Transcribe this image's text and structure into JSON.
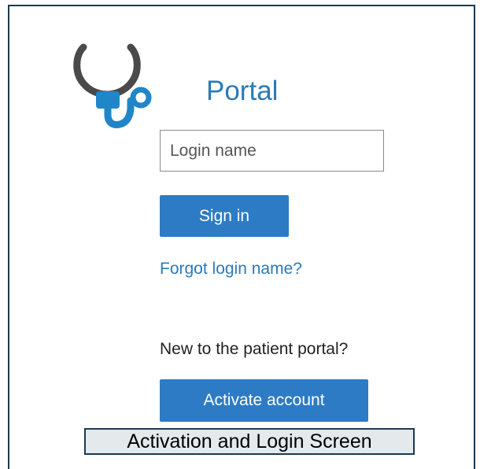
{
  "header": {
    "logo_icon": "stethoscope-icon",
    "title": "Portal"
  },
  "login": {
    "placeholder": "Login name",
    "value": "",
    "sign_in_label": "Sign in",
    "forgot_label": "Forgot login name?"
  },
  "activation": {
    "prompt": "New to the patient portal?",
    "activate_label": "Activate account"
  },
  "caption": {
    "text": "Activation and Login Screen"
  },
  "colors": {
    "accent": "#2d7bc4",
    "title_blue": "#2a7ab8",
    "logo_gray": "#4a4a4a",
    "logo_blue": "#1f86c8",
    "frame_border": "#1b3a52",
    "caption_bg": "#e4e9ec"
  }
}
